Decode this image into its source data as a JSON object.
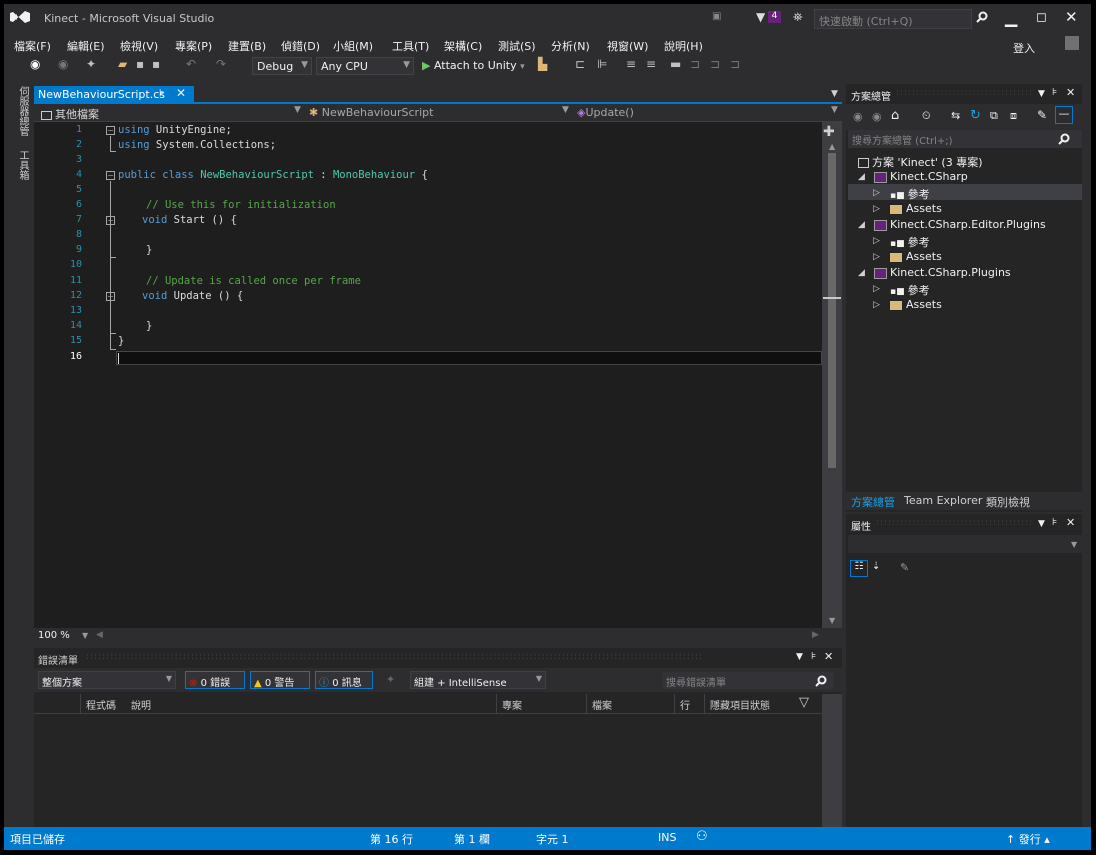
{
  "title_bar": {
    "app_title": "Kinect - Microsoft Visual Studio",
    "notification_count": "4",
    "quick_launch_placeholder": "快速啟動 (Ctrl+Q)",
    "sign_in": "登入"
  },
  "menu": [
    "檔案(F)",
    "編輯(E)",
    "檢視(V)",
    "專案(P)",
    "建置(B)",
    "偵錯(D)",
    "小組(M)",
    "工具(T)",
    "架構(C)",
    "測試(S)",
    "分析(N)",
    "視窗(W)",
    "說明(H)"
  ],
  "toolbar": {
    "config": "Debug",
    "platform": "Any CPU",
    "attach": "Attach to Unity"
  },
  "left_strip": {
    "server_explorer": "伺服器總管",
    "toolbox": "工具箱"
  },
  "editor": {
    "tab_label": "NewBehaviourScript.cs",
    "nav_project": "其他檔案",
    "nav_class": "NewBehaviourScript",
    "nav_member": "Update()",
    "zoom": "100 %",
    "lines": [
      "1",
      "2",
      "3",
      "4",
      "5",
      "6",
      "7",
      "8",
      "9",
      "10",
      "11",
      "12",
      "13",
      "14",
      "15",
      "16"
    ],
    "code": {
      "l1_kw": "using",
      "l1_rest": " UnityEngine;",
      "l2_kw": "using",
      "l2_rest": " System.Collections;",
      "l4_kw": "public class",
      "l4_type": "NewBehaviourScript",
      "l4_sep": " : ",
      "l4_base": "MonoBehaviour",
      "l4_brace": " {",
      "l6_comment": "// Use this for initialization",
      "l7_kw": "void",
      "l7_rest": " Start () {",
      "l9": "}",
      "l11_comment": "// Update is called once per frame",
      "l12_kw": "void",
      "l12_rest": " Update () {",
      "l14": "}",
      "l15": "}"
    }
  },
  "error_list": {
    "title": "錯誤清單",
    "scope": "整個方案",
    "errors": "0 錯誤",
    "warnings": "0 警告",
    "messages": "0 訊息",
    "build_filter": "組建 + IntelliSense",
    "search_placeholder": "搜尋錯誤清單",
    "columns": [
      "程式碼",
      "說明",
      "專案",
      "檔案",
      "行",
      "隱藏項目狀態"
    ]
  },
  "solution_explorer": {
    "title": "方案總管",
    "search_placeholder": "搜尋方案總管 (Ctrl+;)",
    "solution": "方案 'Kinect' (3 專案)",
    "projects": [
      {
        "name": "Kinect.CSharp",
        "refs": "參考",
        "assets": "Assets"
      },
      {
        "name": "Kinect.CSharp.Editor.Plugins",
        "refs": "參考",
        "assets": "Assets"
      },
      {
        "name": "Kinect.CSharp.Plugins",
        "refs": "參考",
        "assets": "Assets"
      }
    ],
    "tabs": [
      "方案總管",
      "Team Explorer",
      "類別檢視"
    ]
  },
  "properties": {
    "title": "屬性"
  },
  "status_bar": {
    "state": "項目已儲存",
    "line": "第 16 行",
    "col": "第 1 欄",
    "char": "字元 1",
    "mode": "INS",
    "publish": "發行"
  },
  "colors": {
    "accent": "#007acc",
    "background": "#2d2d30",
    "editor": "#1e1e1e"
  }
}
